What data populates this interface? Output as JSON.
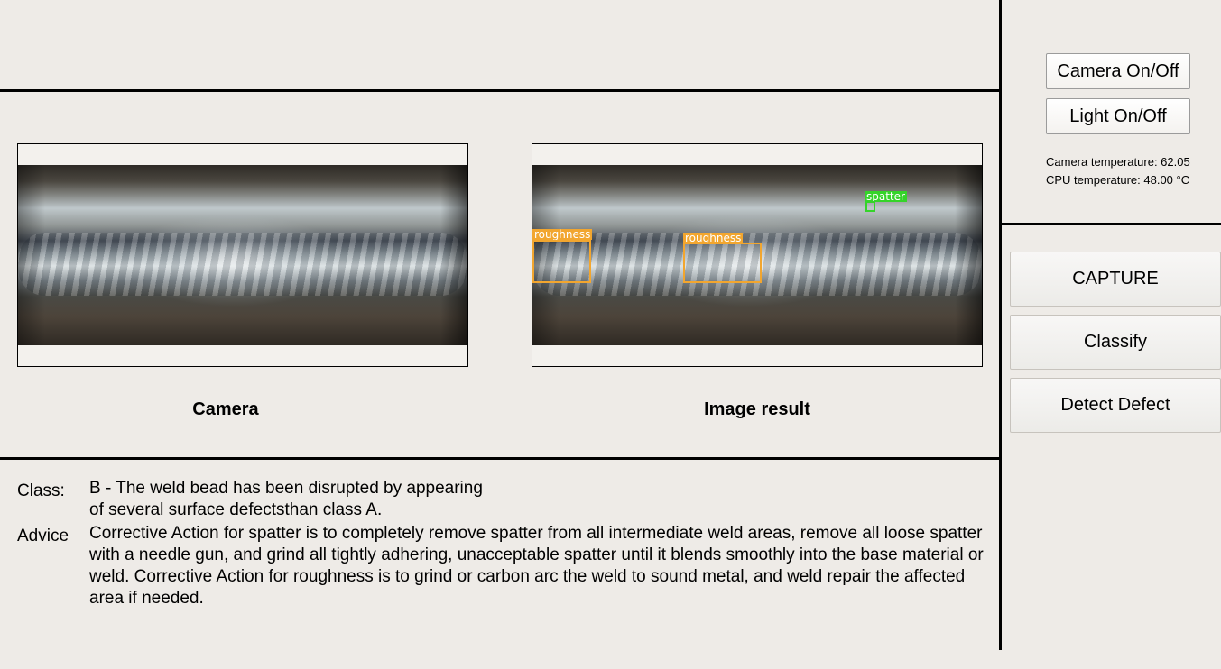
{
  "panels": {
    "camera": {
      "caption": "Camera"
    },
    "result": {
      "caption": "Image result",
      "detections": [
        {
          "label": "roughness",
          "color": "#f2a62f"
        },
        {
          "label": "roughness",
          "color": "#f2a62f"
        },
        {
          "label": "spatter",
          "color": "#35d42a"
        }
      ]
    }
  },
  "controls": {
    "camera_toggle": "Camera On/Off",
    "light_toggle": "Light On/Off",
    "camera_temp": "Camera temperature: 62.05",
    "cpu_temp": "CPU temperature: 48.00 °C",
    "capture": "CAPTURE",
    "classify": "Classify",
    "detect": "Detect Defect"
  },
  "output": {
    "class_label": "Class:",
    "class_line1": "B - The weld bead has been disrupted by appearing",
    "class_line2": "of several surface defectsthan class A.",
    "advice_label": "Advice",
    "advice_text": "Corrective Action for spatter is to completely remove spatter from all intermediate weld areas, remove all loose spatter with a needle gun, and grind all tightly adhering, unacceptable spatter until it blends smoothly into the base material or weld. Corrective Action for roughness is to grind or carbon arc the weld to sound metal, and weld repair the affected area if needed."
  }
}
